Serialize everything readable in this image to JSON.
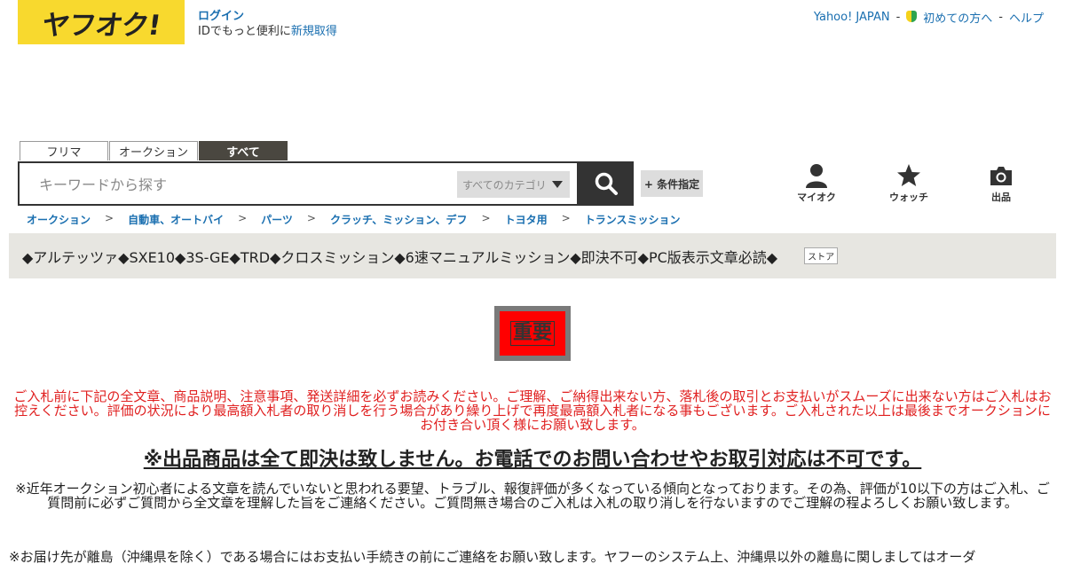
{
  "header": {
    "logo_text": "ヤフオク!",
    "login_label": "ログイン",
    "login_note_prefix": "IDでもっと便利に",
    "register_label": "新規取得",
    "top_links": [
      "Yahoo! JAPAN",
      "初めての方へ",
      "ヘルプ"
    ],
    "separator": "-"
  },
  "search": {
    "tabs": [
      "フリマ",
      "オークション",
      "すべて"
    ],
    "active_tab": "すべて",
    "placeholder": "キーワードから探す",
    "value": "",
    "category_label": "すべてのカテゴリ",
    "condition_label": "+ 条件指定",
    "icons": {
      "search": "magnifier-icon",
      "category": "triangle-down-icon"
    }
  },
  "nav_icons": [
    {
      "label": "マイオク",
      "icon": "person-icon"
    },
    {
      "label": "ウォッチ",
      "icon": "star-icon"
    },
    {
      "label": "出品",
      "icon": "camera-icon"
    }
  ],
  "breadcrumb": {
    "items": [
      "オークション",
      "自動車、オートバイ",
      "パーツ",
      "クラッチ、ミッション、デフ",
      "トヨタ用",
      "トランスミッション"
    ],
    "separator": ">"
  },
  "item": {
    "title": "◆アルテッツァ◆SXE10◆3S-GE◆TRD◆クロスミッション◆6速マニュアルミッション◆即決不可◆PC版表示文章必読◆",
    "store_badge": "ストア"
  },
  "description": {
    "important_label": "重要",
    "warning": "ご入札前に下記の全文章、商品説明、注意事項、発送詳細を必ずお読みください。ご理解、ご納得出来ない方、落札後の取引とお支払いがスムーズに出来ない方はご入札はお控えください。評価の状況により最高額入札者の取り消しを行う場合があり繰り上げで再度最高額入札者になる事もございます。ご入札された以上は最後までオークションにお付き合い頂く様にお願い致します。",
    "headline": "※出品商品は全て即決は致しません。お電話でのお問い合わせやお取引対応は不可です。",
    "note": "※近年オークション初心者による文章を読んでいないと思われる要望、トラブル、報復評価が多くなっている傾向となっております。その為、評価が10以下の方はご入札、ご質問前に必ずご質問から全文章を理解した旨をご連絡ください。ご質問無き場合のご入札は入札の取り消しを行ないますのでご理解の程よろしくお願い致します。",
    "note2": "※お届け先が離島（沖縄県を除く）である場合にはお支払い手続きの前にご連絡をお願い致します。ヤフーのシステム上、沖縄県以外の離島に関しましてはオーダ"
  },
  "colors": {
    "logo_bg": "#f8d92e",
    "link": "#1a6fb0",
    "warning_text": "#e02020",
    "important_bg": "#ff0000",
    "title_bar_bg": "#e7e6e1",
    "active_tab_bg": "#4a4740"
  }
}
